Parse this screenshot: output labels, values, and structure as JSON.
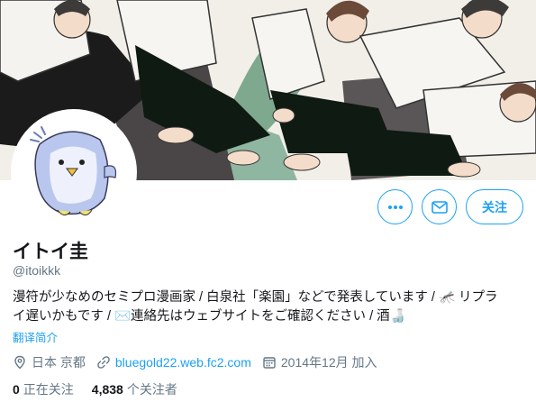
{
  "profile": {
    "display_name": "イトイ圭",
    "handle": "@itoikkk",
    "bio_line1": "漫符が少なめのセミプロ漫画家 / 白泉社「楽園」などで発表しています / 🦟 リプラ",
    "bio_line2": "イ遅いかもです / ✉️連絡先はウェブサイトをご確認ください / 酒🍶",
    "translate_label": "翻译简介",
    "location": "日本 京都",
    "website": "bluegold22.web.fc2.com",
    "joined": "2014年12月 加入"
  },
  "stats": {
    "following_count": "0",
    "following_label": "正在关注",
    "followers_count": "4,838",
    "followers_label": "个关注者"
  },
  "actions": {
    "follow_label": "关注",
    "more_icon": "more-icon",
    "message_icon": "envelope-icon"
  },
  "colors": {
    "accent": "#1da1f2",
    "secondary_text": "#657786"
  }
}
